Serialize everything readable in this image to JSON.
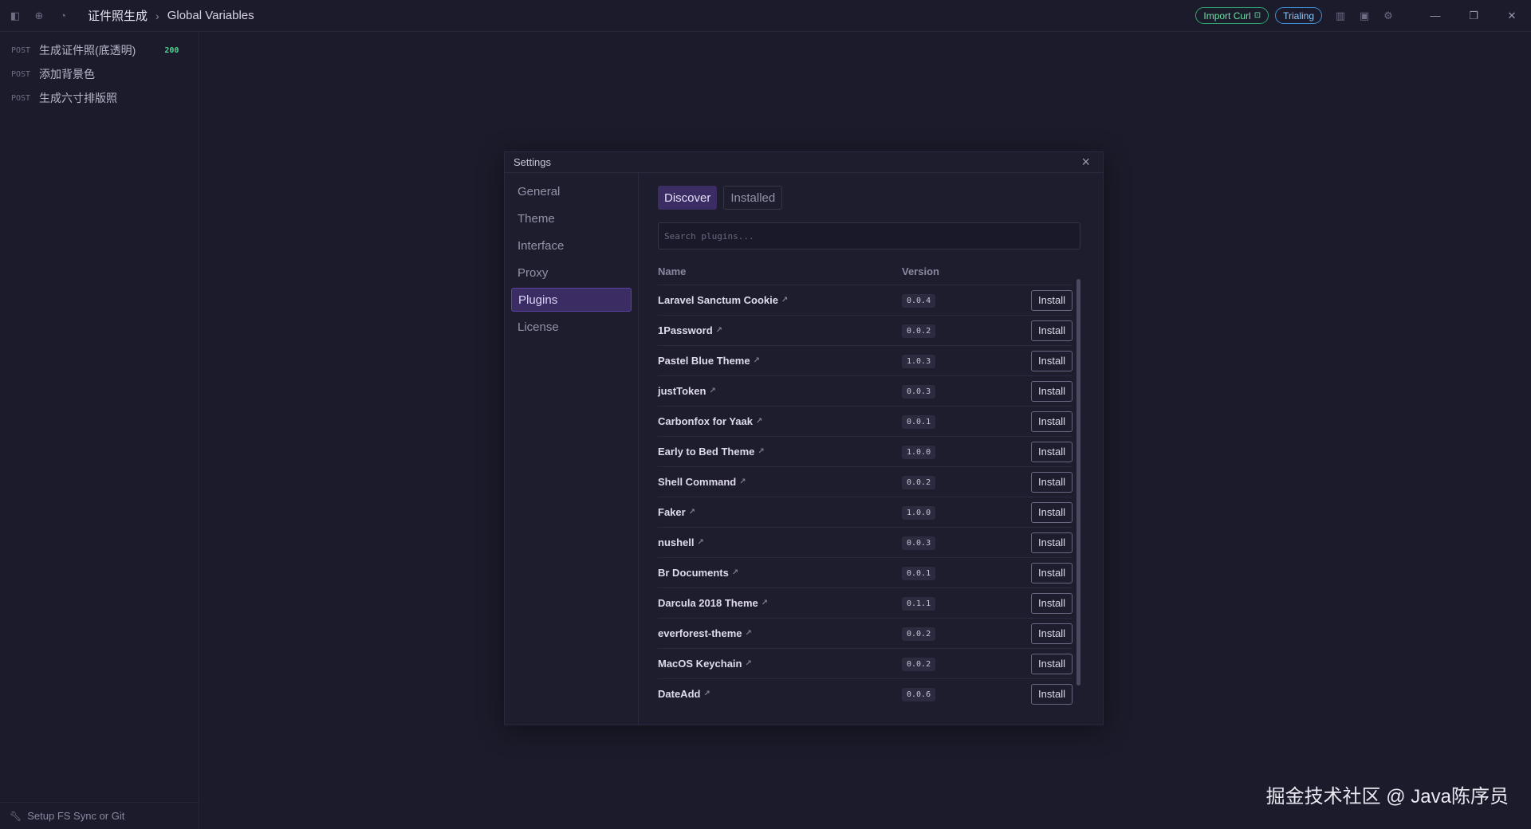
{
  "topbar": {
    "workspace": "证件照生成",
    "environment": "Global Variables",
    "import_curl": "Import Curl",
    "trial": "Trialing"
  },
  "sidebar": {
    "requests": [
      {
        "method": "POST",
        "name": "生成证件照(底透明)",
        "status": "200"
      },
      {
        "method": "POST",
        "name": "添加背景色",
        "status": ""
      },
      {
        "method": "POST",
        "name": "生成六寸排版照",
        "status": ""
      }
    ],
    "footer": "Setup FS Sync or Git"
  },
  "settings": {
    "title": "Settings",
    "nav": [
      "General",
      "Theme",
      "Interface",
      "Proxy",
      "Plugins",
      "License"
    ],
    "active_nav": "Plugins",
    "tabs": [
      "Discover",
      "Installed"
    ],
    "search_placeholder": "Search plugins...",
    "columns": {
      "name": "Name",
      "version": "Version"
    },
    "install_label": "Install",
    "plugins": [
      {
        "name": "Laravel Sanctum Cookie",
        "version": "0.0.4"
      },
      {
        "name": "1Password",
        "version": "0.0.2"
      },
      {
        "name": "Pastel Blue Theme",
        "version": "1.0.3"
      },
      {
        "name": "justToken",
        "version": "0.0.3"
      },
      {
        "name": "Carbonfox for Yaak",
        "version": "0.0.1"
      },
      {
        "name": "Early to Bed Theme",
        "version": "1.0.0"
      },
      {
        "name": "Shell Command",
        "version": "0.0.2"
      },
      {
        "name": "Faker",
        "version": "1.0.0"
      },
      {
        "name": "nushell",
        "version": "0.0.3"
      },
      {
        "name": "Br Documents",
        "version": "0.0.1"
      },
      {
        "name": "Darcula 2018 Theme",
        "version": "0.1.1"
      },
      {
        "name": "everforest-theme",
        "version": "0.0.2"
      },
      {
        "name": "MacOS Keychain",
        "version": "0.0.2"
      },
      {
        "name": "DateAdd",
        "version": "0.0.6"
      }
    ]
  },
  "watermark": "掘金技术社区 @ Java陈序员"
}
